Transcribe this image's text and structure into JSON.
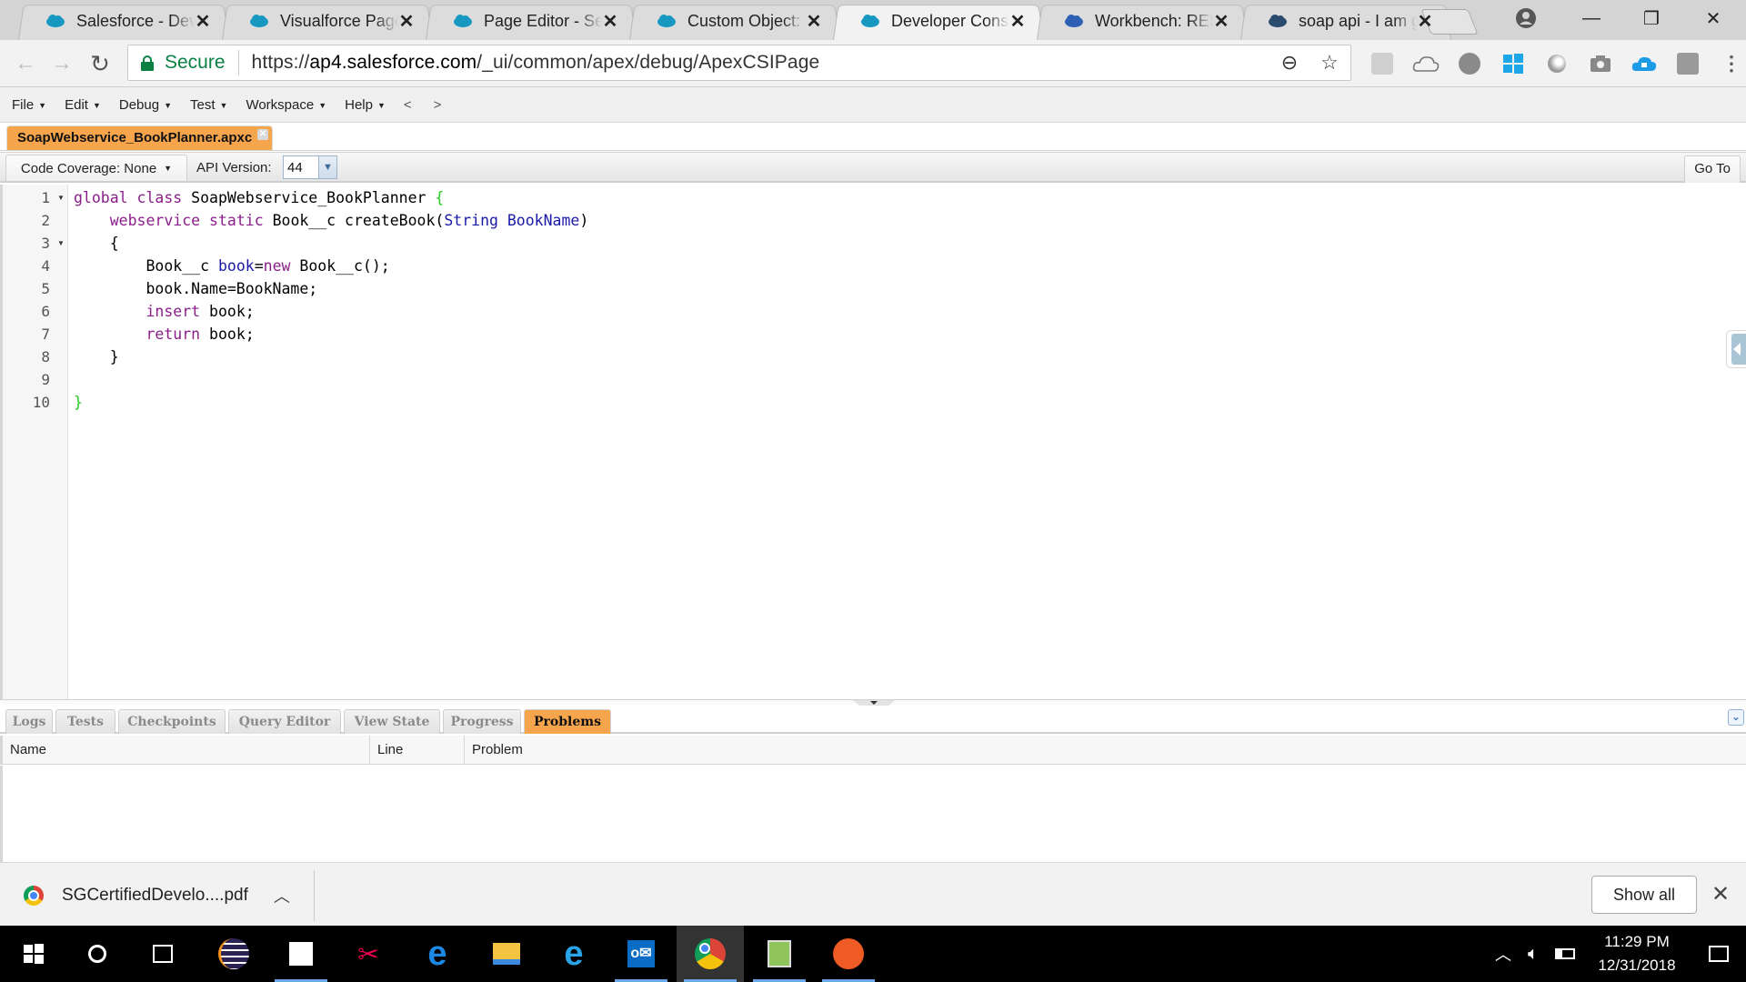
{
  "browser": {
    "tabs": [
      {
        "title": "Salesforce - Developer Edition",
        "icon": "salesforce-cloud-icon",
        "active": false
      },
      {
        "title": "Visualforce Page:",
        "icon": "salesforce-cloud-icon",
        "active": false
      },
      {
        "title": "Page Editor - Session",
        "icon": "salesforce-cloud-icon",
        "active": false
      },
      {
        "title": "Custom Object: Book",
        "icon": "salesforce-cloud-icon",
        "active": false
      },
      {
        "title": "Developer Console",
        "icon": "salesforce-cloud-icon",
        "active": true
      },
      {
        "title": "Workbench: REST",
        "icon": "workbench-cube-icon",
        "active": false
      },
      {
        "title": "soap api - I am getting",
        "icon": "stackexchange-cloud-icon",
        "active": false
      }
    ],
    "close_glyph": "✕",
    "window_controls": {
      "minimize": "—",
      "restore": "❐",
      "close": "✕"
    },
    "address": {
      "secure_label": "Secure",
      "url_scheme": "https://",
      "url_host": "ap4.salesforce.com",
      "url_path": "/_ui/common/apex/debug/ApexCSIPage"
    },
    "extensions": [
      "inspector-icon",
      "cloud-icon",
      "dev-c-icon",
      "windows-icon",
      "circle-icon",
      "camera-icon",
      "cloud-lock-icon",
      "forcecom-icon"
    ]
  },
  "console": {
    "menus": [
      {
        "label": "File"
      },
      {
        "label": "Edit"
      },
      {
        "label": "Debug"
      },
      {
        "label": "Test"
      },
      {
        "label": "Workspace"
      },
      {
        "label": "Help"
      }
    ],
    "nav_back": "<",
    "nav_forward": ">",
    "open_file": "SoapWebservice_BookPlanner.apxc",
    "code_coverage_label": "Code Coverage: None",
    "api_version_label": "API Version:",
    "api_version_value": "44",
    "goto_label": "Go To",
    "code": {
      "line_numbers": [
        "1",
        "2",
        "3",
        "4",
        "5",
        "6",
        "7",
        "8",
        "9",
        "10"
      ],
      "foldable_lines": [
        1,
        3
      ],
      "lines": [
        [
          {
            "t": "global class",
            "c": "kw"
          },
          {
            "t": " SoapWebservice_BookPlanner ",
            "c": ""
          },
          {
            "t": "{",
            "c": "br"
          }
        ],
        [
          {
            "t": "    ",
            "c": ""
          },
          {
            "t": "webservice static",
            "c": "kw"
          },
          {
            "t": " Book__c createBook(",
            "c": ""
          },
          {
            "t": "String BookName",
            "c": "ty"
          },
          {
            "t": ")",
            "c": ""
          }
        ],
        [
          {
            "t": "    {",
            "c": ""
          }
        ],
        [
          {
            "t": "        Book__c ",
            "c": ""
          },
          {
            "t": "book",
            "c": "ty"
          },
          {
            "t": "=",
            "c": ""
          },
          {
            "t": "new",
            "c": "kw"
          },
          {
            "t": " Book__c();",
            "c": ""
          }
        ],
        [
          {
            "t": "        book.Name=BookName;",
            "c": ""
          }
        ],
        [
          {
            "t": "        ",
            "c": ""
          },
          {
            "t": "insert",
            "c": "kw"
          },
          {
            "t": " book;",
            "c": ""
          }
        ],
        [
          {
            "t": "        ",
            "c": ""
          },
          {
            "t": "return",
            "c": "kw"
          },
          {
            "t": " book;",
            "c": ""
          }
        ],
        [
          {
            "t": "    }",
            "c": ""
          }
        ],
        [
          {
            "t": "",
            "c": ""
          }
        ],
        [
          {
            "t": "}",
            "c": "br"
          }
        ]
      ]
    },
    "bottom_tabs": [
      {
        "label": "Logs",
        "active": false
      },
      {
        "label": "Tests",
        "active": false
      },
      {
        "label": "Checkpoints",
        "active": false
      },
      {
        "label": "Query Editor",
        "active": false
      },
      {
        "label": "View State",
        "active": false
      },
      {
        "label": "Progress",
        "active": false
      },
      {
        "label": "Problems",
        "active": true
      }
    ],
    "problems_columns": [
      "Name",
      "Line",
      "Problem"
    ],
    "problems_rows": []
  },
  "downloads": {
    "file_name": "SGCertifiedDevelo....pdf",
    "show_all_label": "Show all"
  },
  "taskbar": {
    "pinned": [
      "start-icon",
      "cortana-icon",
      "task-view-icon",
      "eclipse-icon",
      "sticky-notes-icon",
      "snipping-tool-icon",
      "edge-icon",
      "file-explorer-icon",
      "internet-explorer-icon",
      "outlook-icon",
      "chrome-icon",
      "notepadplusplus-icon",
      "postman-icon"
    ],
    "time": "11:29 PM",
    "date": "12/31/2018"
  },
  "colors": {
    "accent_orange": "#f7a54c",
    "secure_green": "#0b8043",
    "keyword_purple": "#8a1f8a",
    "type_blue": "#1a1aa6",
    "brace_green": "#22cc22",
    "salesforce_blue": "#1798c1"
  }
}
